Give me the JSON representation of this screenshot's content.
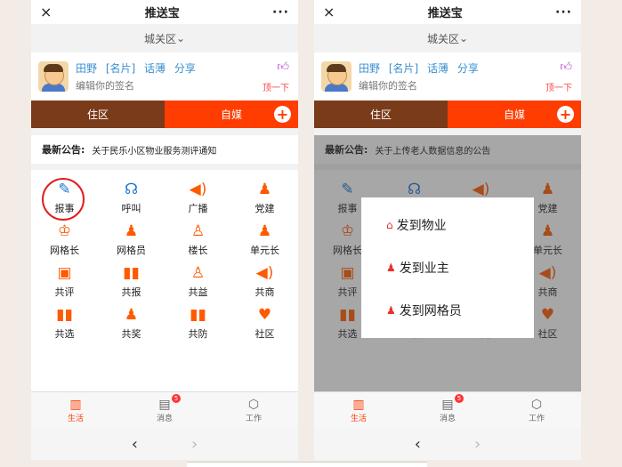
{
  "app_title": "推送宝",
  "close_glyph": "×",
  "more_glyph": "···",
  "location": "城关区",
  "location_caret": "⌄",
  "profile": {
    "name": "田野",
    "card": "[名片]",
    "talk": "话薄",
    "share": "分享",
    "signature": "编辑你的签名",
    "bump": "顶一下"
  },
  "tabs": {
    "left": "住区",
    "right": "自媒",
    "plus": "+"
  },
  "notice_label": "最新公告:",
  "left_notice": "关于民乐小区物业服务测评通知",
  "right_notice": "关于上传老人数据信息的公告",
  "grid_items": [
    {
      "label": "报事",
      "icon": "pencil-icon",
      "glyph": "✎"
    },
    {
      "label": "呼叫",
      "icon": "headset-icon",
      "glyph": "☊"
    },
    {
      "label": "广播",
      "icon": "speaker-icon",
      "glyph": "◀)"
    },
    {
      "label": "党建",
      "icon": "people-icon",
      "glyph": "♟"
    },
    {
      "label": "网格长",
      "icon": "trophy-icon",
      "glyph": "♔"
    },
    {
      "label": "网格员",
      "icon": "people-icon",
      "glyph": "♟"
    },
    {
      "label": "楼长",
      "icon": "user-icon",
      "glyph": "♙"
    },
    {
      "label": "单元长",
      "icon": "people-icon",
      "glyph": "♟"
    },
    {
      "label": "共评",
      "icon": "calendar-icon",
      "glyph": "▣"
    },
    {
      "label": "共报",
      "icon": "bar-chart-icon",
      "glyph": "▮▮"
    },
    {
      "label": "共益",
      "icon": "user-edit-icon",
      "glyph": "♙"
    },
    {
      "label": "共商",
      "icon": "speaker-icon",
      "glyph": "◀)"
    },
    {
      "label": "共选",
      "icon": "bar-chart-icon",
      "glyph": "▮▮"
    },
    {
      "label": "共奖",
      "icon": "group-icon",
      "glyph": "♟"
    },
    {
      "label": "共防",
      "icon": "bar-chart-icon",
      "glyph": "▮▮"
    },
    {
      "label": "社区",
      "icon": "heart-icon",
      "glyph": "♥"
    }
  ],
  "bottom_nav": [
    {
      "label": "生活",
      "glyph": "▥",
      "active": true
    },
    {
      "label": "消息",
      "glyph": "▤",
      "badge": "5"
    },
    {
      "label": "工作",
      "glyph": "⬡"
    }
  ],
  "browser_back": "‹",
  "browser_forward": "›",
  "popup": [
    {
      "label": "发到物业",
      "icon": "home-icon",
      "glyph": "⌂"
    },
    {
      "label": "发到业主",
      "icon": "user-icon",
      "glyph": "♟"
    },
    {
      "label": "发到网格员",
      "icon": "user-icon",
      "glyph": "♟"
    }
  ]
}
